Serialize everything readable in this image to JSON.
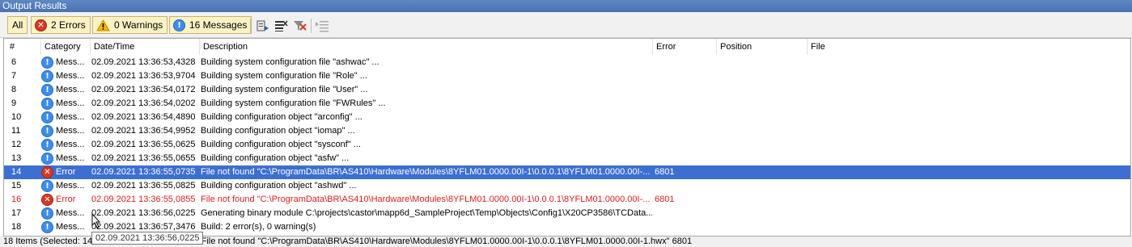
{
  "window": {
    "title": "Output Results"
  },
  "toolbar": {
    "all_label": "All",
    "errors_label": "2 Errors",
    "warnings_label": "0 Warnings",
    "messages_label": "16 Messages"
  },
  "columns": {
    "number": "#",
    "category": "Category",
    "datetime": "Date/Time",
    "description": "Description",
    "error": "Error",
    "position": "Position",
    "file": "File"
  },
  "rows": [
    {
      "num": "6",
      "cat": "Mess...",
      "type": "info",
      "dt": "02.09.2021 13:36:53,4328",
      "desc": "Building system configuration file \"ashwac\" ...",
      "err": ""
    },
    {
      "num": "7",
      "cat": "Mess...",
      "type": "info",
      "dt": "02.09.2021 13:36:53,9704",
      "desc": "Building system configuration file \"Role\" ...",
      "err": ""
    },
    {
      "num": "8",
      "cat": "Mess...",
      "type": "info",
      "dt": "02.09.2021 13:36:54,0172",
      "desc": "Building system configuration file \"User\" ...",
      "err": ""
    },
    {
      "num": "9",
      "cat": "Mess...",
      "type": "info",
      "dt": "02.09.2021 13:36:54,0202",
      "desc": "Building system configuration file \"FWRules\" ...",
      "err": ""
    },
    {
      "num": "10",
      "cat": "Mess...",
      "type": "info",
      "dt": "02.09.2021 13:36:54,4890",
      "desc": "Building configuration object \"arconfig\" ...",
      "err": ""
    },
    {
      "num": "11",
      "cat": "Mess...",
      "type": "info",
      "dt": "02.09.2021 13:36:54,9952",
      "desc": "Building configuration object \"iomap\" ...",
      "err": ""
    },
    {
      "num": "12",
      "cat": "Mess...",
      "type": "info",
      "dt": "02.09.2021 13:36:55,0625",
      "desc": "Building configuration object \"sysconf\" ...",
      "err": ""
    },
    {
      "num": "13",
      "cat": "Mess...",
      "type": "info",
      "dt": "02.09.2021 13:36:55,0655",
      "desc": "Building configuration object \"asfw\" ...",
      "err": ""
    },
    {
      "num": "14",
      "cat": "Error",
      "type": "error",
      "state": "selected",
      "dt": "02.09.2021 13:36:55,0735",
      "desc": "File not found \"C:\\ProgramData\\BR\\AS410\\Hardware\\Modules\\8YFLM01.0000.00I-1\\0.0.0.1\\8YFLM01.0000.00I-...",
      "err": "6801"
    },
    {
      "num": "15",
      "cat": "Mess...",
      "type": "info",
      "dt": "02.09.2021 13:36:55,0825",
      "desc": "Building configuration object \"ashwd\" ...",
      "err": ""
    },
    {
      "num": "16",
      "cat": "Error",
      "type": "error",
      "state": "error",
      "dt": "02.09.2021 13:36:55,0855",
      "desc": "File not found \"C:\\ProgramData\\BR\\AS410\\Hardware\\Modules\\8YFLM01.0000.00I-1\\0.0.0.1\\8YFLM01.0000.00I-...",
      "err": "6801"
    },
    {
      "num": "17",
      "cat": "Mess...",
      "type": "info",
      "dt": "02.09.2021 13:36:56,0225",
      "desc": "Generating binary module C:\\projects\\castor\\mapp6d_SampleProject\\Temp\\Objects\\Config1\\X20CP3586\\TCData...",
      "err": ""
    },
    {
      "num": "18",
      "cat": "Mess...",
      "type": "info",
      "dt": "02.09.2021 13:36:57,3476",
      "desc": "Build: 2 error(s), 0 warning(s)",
      "err": ""
    }
  ],
  "tooltip": {
    "text": "02.09.2021 13:36:56,0225"
  },
  "statusbar": {
    "text": "18 Items (Selected: 14 02.09.2021 13:36:55,0735 File not found \"C:\\ProgramData\\BR\\AS410\\Hardware\\Modules\\8YFLM01.0000.00I-1\\0.0.0.1\\8YFLM01.0000.00I-1.hwx\" 6801"
  },
  "colors": {
    "title_bar": "#4a72b0",
    "selection": "#3d6fd3",
    "error_text": "#e41c1c",
    "error_icon": "#d33a25",
    "info_icon": "#3d8ee8",
    "filter_button": "#fbf2c4"
  }
}
